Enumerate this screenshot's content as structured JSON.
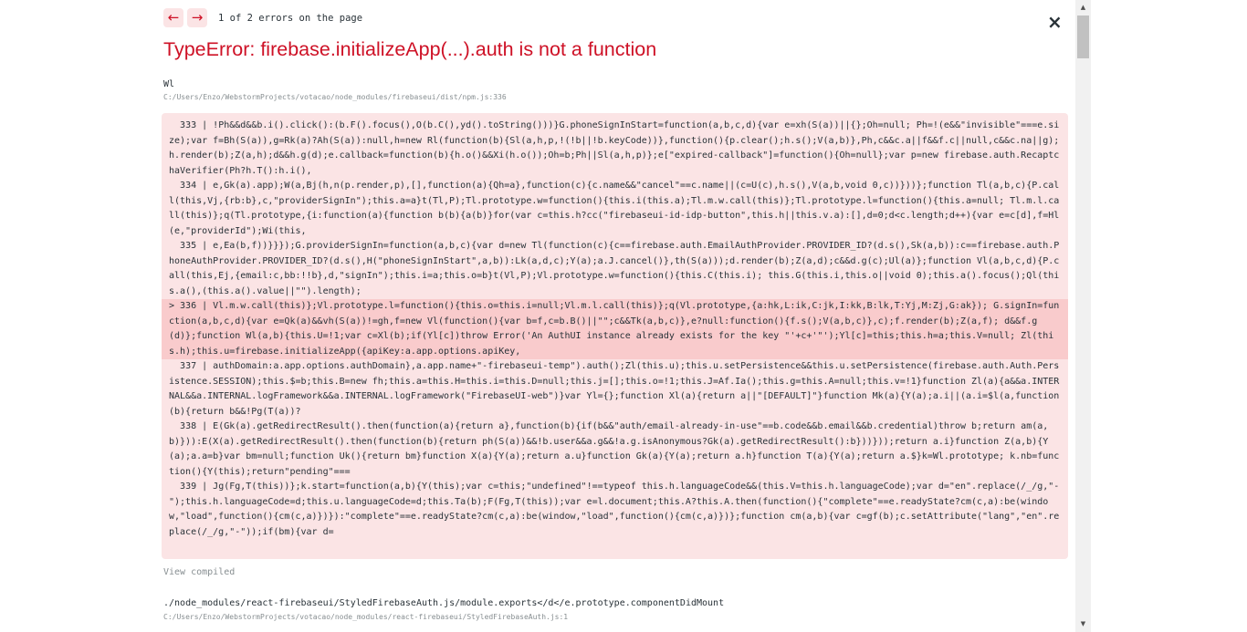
{
  "nav": {
    "prev_icon": "←",
    "next_icon": "→",
    "status": "1 of 2 errors on the page"
  },
  "close_icon": "×",
  "error_title": "TypeError: firebase.initializeApp(...).auth is not a function",
  "frame1": {
    "function": "Wl",
    "location": "C:/Users/Enzo/WebstormProjects/votacao/node_modules/firebaseui/dist/npm.js:336"
  },
  "code_lines": [
    {
      "text": "  333 | !Ph&&d&&b.i().click():(b.F().focus(),O(b.C(),yd().toString()))}G.phoneSignInStart=function(a,b,c,d){var e=xh(S(a))||{};Oh=null; Ph=!(e&&\"invisible\"===e.size);var f=Bh(S(a)),g=Rk(a)?Ah(S(a)):null,h=new Rl(function(b){Sl(a,h,p,!(!b||!b.keyCode))},function(){p.clear();h.s();V(a,b)},Ph,c&&c.a||f&&f.c||null,c&&c.na||g);h.render(b);Z(a,h);d&&h.g(d);e.callback=function(b){h.o()&&Xi(h.o());Oh=b;Ph||Sl(a,h,p)};e[\"expired-callback\"]=function(){Oh=null};var p=new firebase.auth.RecaptchaVerifier(Ph?h.T():h.i(),",
      "hl": false
    },
    {
      "text": "  334 | e,Gk(a).app);W(a,Bj(h,n(p.render,p),[],function(a){Qh=a},function(c){c.name&&\"cancel\"==c.name||(c=U(c),h.s(),V(a,b,void 0,c))}))};function Tl(a,b,c){P.call(this,Vj,{rb:b},c,\"providerSignIn\");this.a=a}t(Tl,P);Tl.prototype.w=function(){this.i(this.a);Tl.m.w.call(this)};Tl.prototype.l=function(){this.a=null; Tl.m.l.call(this)};q(Tl.prototype,{i:function(a){function b(b){a(b)}for(var c=this.h?cc(\"firebaseui-id-idp-button\",this.h||this.v.a):[],d=0;d<c.length;d++){var e=c[d],f=Hl(e,\"providerId\");Wi(this,",
      "hl": false
    },
    {
      "text": "  335 | e,Ea(b,f))}}});G.providerSignIn=function(a,b,c){var d=new Tl(function(c){c==firebase.auth.EmailAuthProvider.PROVIDER_ID?(d.s(),Sk(a,b)):c==firebase.auth.PhoneAuthProvider.PROVIDER_ID?(d.s(),H(\"phoneSignInStart\",a,b)):Lk(a,d,c);Y(a);a.J.cancel()},th(S(a)));d.render(b);Z(a,d);c&&d.g(c);Ul(a)};function Vl(a,b,c,d){P.call(this,Ej,{email:c,bb:!!b},d,\"signIn\");this.i=a;this.o=b}t(Vl,P);Vl.prototype.w=function(){this.C(this.i); this.G(this.i,this.o||void 0);this.a().focus();Ql(this.a(),(this.a().value||\"\").length);",
      "hl": false
    },
    {
      "text": "> 336 | Vl.m.w.call(this)};Vl.prototype.l=function(){this.o=this.i=null;Vl.m.l.call(this)};q(Vl.prototype,{a:hk,L:ik,C:jk,I:kk,B:lk,T:Yj,M:Zj,G:ak}); G.signIn=function(a,b,c,d){var e=Qk(a)&&vh(S(a))!=gh,f=new Vl(function(){var b=f,c=b.B()||\"\";c&&Tk(a,b,c)},e?null:function(){f.s();V(a,b,c)},c);f.render(b);Z(a,f); d&&f.g(d)};function Wl(a,b){this.U=!1;var c=Xl(b);if(Yl[c])throw Error('An AuthUI instance already exists for the key \"'+c+'\"');Yl[c]=this;this.h=a;this.V=null; Zl(this.h);this.u=firebase.initializeApp({apiKey:a.app.options.apiKey,",
      "hl": true
    },
    {
      "text": "  337 | authDomain:a.app.options.authDomain},a.app.name+\"-firebaseui-temp\").auth();Zl(this.u);this.u.setPersistence&&this.u.setPersistence(firebase.auth.Auth.Persistence.SESSION);this.$=b;this.B=new fh;this.a=this.H=this.i=this.D=null;this.j=[];this.o=!1;this.J=Af.Ia();this.g=this.A=null;this.v=!1}function Zl(a){a&&a.INTERNAL&&a.INTERNAL.logFramework&&a.INTERNAL.logFramework(\"FirebaseUI-web\")}var Yl={};function Xl(a){return a||\"[DEFAULT]\"}function Mk(a){Y(a);a.i||(a.i=$l(a,function(b){return b&&!Pg(T(a))?",
      "hl": false
    },
    {
      "text": "  338 | E(Gk(a).getRedirectResult().then(function(a){return a},function(b){if(b&&\"auth/email-already-in-use\"==b.code&&b.email&&b.credential)throw b;return am(a,b)})):E(X(a).getRedirectResult().then(function(b){return ph(S(a))&&!b.user&&a.g&&!a.g.isAnonymous?Gk(a).getRedirectResult():b}))}));return a.i}function Z(a,b){Y(a);a.a=b}var bm=null;function Uk(){return bm}function X(a){Y(a);return a.u}function Gk(a){Y(a);return a.h}function T(a){Y(a);return a.$}k=Wl.prototype; k.nb=function(){Y(this);return\"pending\"===",
      "hl": false
    },
    {
      "text": "  339 | Jg(Fg,T(this))};k.start=function(a,b){Y(this);var c=this;\"undefined\"!==typeof this.h.languageCode&&(this.V=this.h.languageCode);var d=\"en\".replace(/_/g,\"-\");this.h.languageCode=d;this.u.languageCode=d;this.Ta(b);F(Fg,T(this));var e=l.document;this.A?this.A.then(function(){\"complete\"==e.readyState?cm(c,a):be(window,\"load\",function(){cm(c,a)})}):\"complete\"==e.readyState?cm(c,a):be(window,\"load\",function(){cm(c,a)})};function cm(a,b){var c=gf(b);c.setAttribute(\"lang\",\"en\".replace(/_/g,\"-\"));if(bm){var d=",
      "hl": false
    }
  ],
  "view_compiled": "View compiled",
  "frame2": {
    "function": "./node_modules/react-firebaseui/StyledFirebaseAuth.js/module.exports</d</e.prototype.componentDidMount",
    "location": "C:/Users/Enzo/WebstormProjects/votacao/node_modules/react-firebaseui/StyledFirebaseAuth.js:1"
  },
  "scrollbar": {
    "up_icon": "▲",
    "down_icon": "▼"
  },
  "colors": {
    "error_red": "#ce1126",
    "code_bg": "#fbe4e5",
    "highlight_bg": "#f9cbcc",
    "muted": "#878e91"
  }
}
